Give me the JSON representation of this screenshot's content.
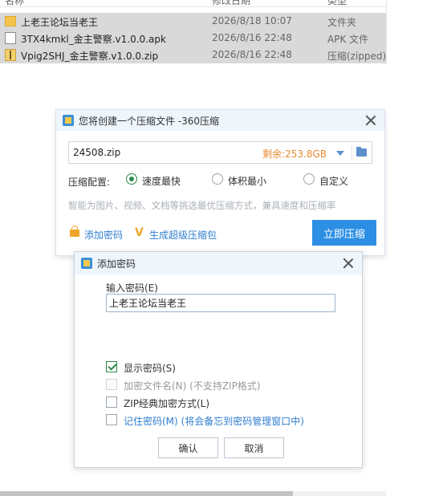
{
  "explorer": {
    "columns": [
      "名称",
      "修改日期",
      "类型"
    ],
    "files": [
      {
        "name": "上老王论坛当老王",
        "date": "2026/8/18 10:07",
        "type": "文件夹",
        "icon": "folder-icon"
      },
      {
        "name": "3TX4kmkl_金主警察.v1.0.0.apk",
        "date": "2026/8/16 22:48",
        "type": "APK 文件",
        "icon": "document-icon"
      },
      {
        "name": "Vpig2SHJ_金主警察.v1.0.0.zip",
        "date": "2026/8/16 22:48",
        "type": "压缩(zipped)",
        "icon": "zip-icon"
      }
    ]
  },
  "compress_dialog": {
    "title": "您将创建一个压缩文件 -360压缩",
    "filename": "24508.zip",
    "free_space": "剩余:253.8GB",
    "config_label": "压缩配置:",
    "options": [
      {
        "label": "速度最快",
        "checked": true
      },
      {
        "label": "体积最小",
        "checked": false
      },
      {
        "label": "自定义",
        "checked": false
      }
    ],
    "hint": "智能为图片、视频、文档等挑选最优压缩方式，兼具速度和压缩率",
    "add_password_link": "添加密码",
    "super_pack_link": "生成超级压缩包",
    "compress_button": "立即压缩",
    "accent_color": "#2d8fe4"
  },
  "password_dialog": {
    "title": "添加密码",
    "input_label": "输入密码(E)",
    "password_value": "上老王论坛当老王",
    "show_password": "显示密码(S)",
    "encrypt_filename": "加密文件名(N) (不支持ZIP格式)",
    "zip_classic": "ZIP经典加密方式(L)",
    "remember_password": "记住密码(M) (将会备忘到密码管理窗口中)",
    "ok_button": "确认",
    "cancel_button": "取消"
  }
}
